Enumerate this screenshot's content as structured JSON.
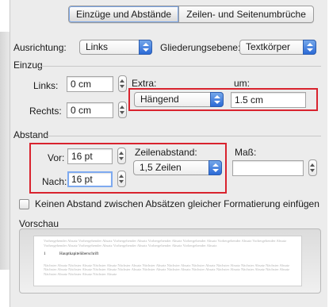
{
  "tabs": {
    "active": "Einzüge und Abstände",
    "other": "Zeilen- und Seitenumbrüche"
  },
  "ausrichtung": {
    "label": "Ausrichtung:",
    "value": "Links"
  },
  "gliederung": {
    "label": "Gliederungsebene:",
    "value": "Textkörper"
  },
  "einzug": {
    "title": "Einzug",
    "links_label": "Links:",
    "links_value": "0 cm",
    "rechts_label": "Rechts:",
    "rechts_value": "0 cm",
    "extra_label": "Extra:",
    "extra_value": "Hängend",
    "um_label": "um:",
    "um_value": "1.5 cm"
  },
  "abstand": {
    "title": "Abstand",
    "vor_label": "Vor:",
    "vor_value": "16 pt",
    "nach_label": "Nach:",
    "nach_value": "16 pt",
    "zeilen_label": "Zeilenabstand:",
    "zeilen_value": "1,5 Zeilen",
    "mass_label": "Maß:",
    "mass_value": ""
  },
  "checkbox": {
    "label": "Keinen Abstand zwischen Absätzen gleicher Formatierung einfügen",
    "checked": false
  },
  "vorschau": {
    "title": "Vorschau",
    "prev_text": "Vorhergehender Absatz Vorhergehender Absatz Vorhergehender Absatz Vorhergehender Absatz Vorhergehender Absatz Vorhergehender Absatz Vorhergehender Absatz Vorhergehender Absatz Vorhergehender Absatz Vorhergehender Absatz Vorhergehender Absatz Vorhergehender Absatz",
    "main_num": "1",
    "main_text": "Hauptkapitelüberschrift",
    "next_text": "Nächster Absatz Nächster Absatz Nächster Absatz Nächster Absatz Nächster Absatz Nächster Absatz Nächster Absatz Nächster Absatz Nächster Absatz Nächster Absatz Nächster Absatz Nächster Absatz Nächster Absatz Nächster Absatz Nächster Absatz Nächster Absatz Nächster Absatz Nächster Absatz Nächster Absatz Nächster Absatz Nächster Absatz Nächster Absatz Nächster Absatz"
  },
  "colors": {
    "highlight": "#d9232e",
    "accent": "#2c6ad6",
    "focus": "#7eaaf0"
  },
  "icons": {
    "popup": "chevron-updown-icon",
    "stepper": "stepper-arrows-icon"
  }
}
